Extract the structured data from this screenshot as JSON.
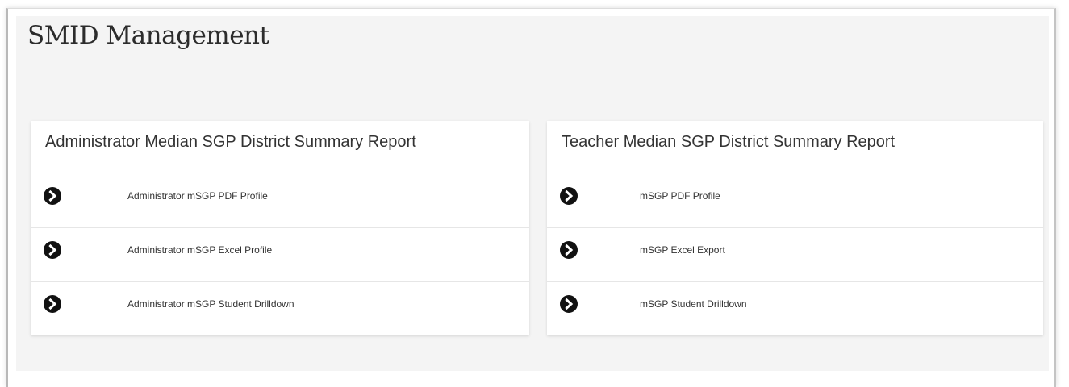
{
  "page": {
    "title": "SMID Management"
  },
  "cards": {
    "administrator": {
      "title": "Administrator Median SGP District Summary Report",
      "items": [
        {
          "label": "Administrator mSGP PDF Profile",
          "icon": "chevron-right-circle-icon"
        },
        {
          "label": "Administrator mSGP Excel Profile",
          "icon": "chevron-right-circle-icon"
        },
        {
          "label": "Administrator mSGP Student Drilldown",
          "icon": "chevron-right-circle-icon"
        }
      ]
    },
    "teacher": {
      "title": "Teacher Median SGP District Summary Report",
      "items": [
        {
          "label": "mSGP PDF Profile",
          "icon": "chevron-right-circle-icon"
        },
        {
          "label": "mSGP Excel Export",
          "icon": "chevron-right-circle-icon"
        },
        {
          "label": "mSGP Student Drilldown",
          "icon": "chevron-right-circle-icon"
        }
      ]
    }
  },
  "colors": {
    "panel_background": "#f4f4f4",
    "card_background": "#ffffff",
    "icon": "#111111",
    "text": "#333333"
  }
}
